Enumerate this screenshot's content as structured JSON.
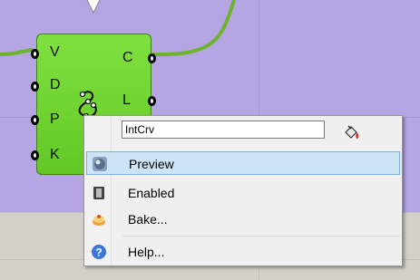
{
  "component": {
    "inputs": [
      "V",
      "D",
      "P",
      "K"
    ],
    "outputs": [
      "C",
      "L"
    ]
  },
  "context_menu": {
    "name_value": "IntCrv",
    "items": [
      {
        "label": "Preview",
        "icon": "preview-icon",
        "selected": true
      },
      {
        "label": "Enabled",
        "icon": "enabled-icon",
        "selected": false
      },
      {
        "label": "Bake...",
        "icon": "bake-icon",
        "selected": false
      },
      {
        "label": "Help...",
        "icon": "help-icon",
        "selected": false
      }
    ]
  },
  "colors": {
    "canvas_purple": "#b5a5e3",
    "component_green": "#6fd232",
    "wire_green": "#6db32d",
    "selection_blue": "#cde4f7"
  }
}
